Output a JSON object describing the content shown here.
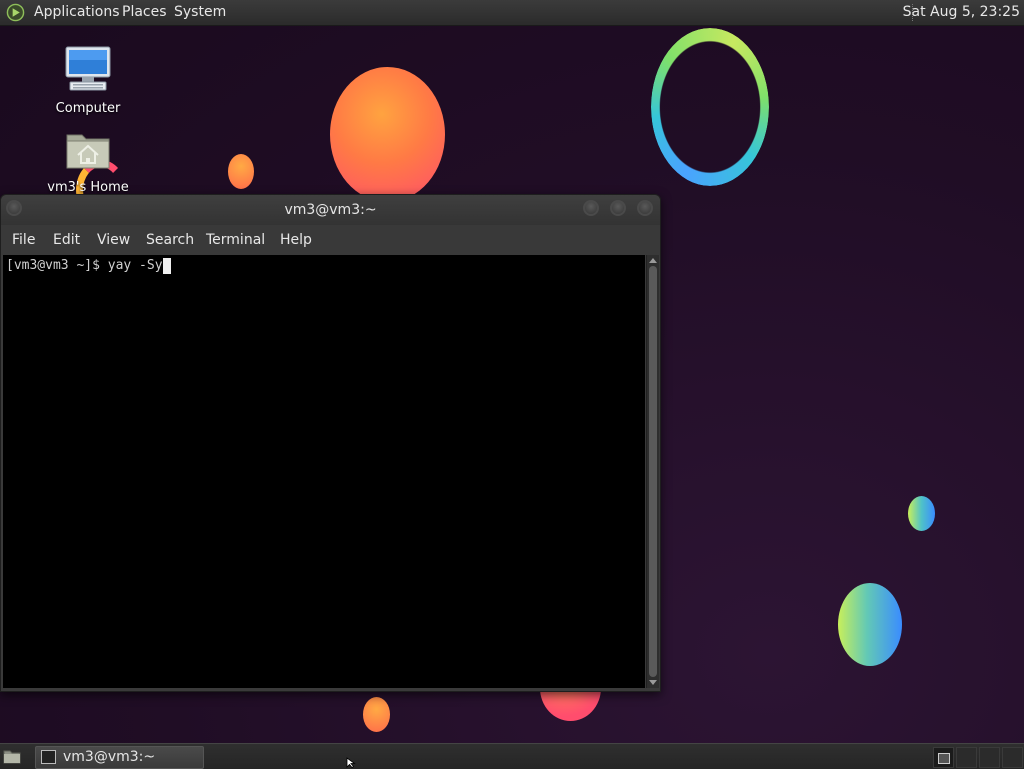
{
  "top_panel": {
    "menus": [
      "Applications",
      "Places",
      "System"
    ],
    "clock": "Sat Aug  5, 23:25"
  },
  "desktop": {
    "icons": [
      {
        "label": "Computer",
        "icon": "computer-icon"
      },
      {
        "label": "vm3's Home",
        "icon": "home-folder-icon"
      }
    ]
  },
  "terminal": {
    "title": "vm3@vm3:~",
    "menu": [
      "File",
      "Edit",
      "View",
      "Search",
      "Terminal",
      "Help"
    ],
    "prompt": "[vm3@vm3 ~]$ ",
    "command": "yay -Sy"
  },
  "bottom_panel": {
    "tasks": [
      {
        "label": "vm3@vm3:~",
        "icon": "terminal-icon"
      }
    ]
  },
  "colors": {
    "panel": "#2f2f2f",
    "wallpaper": "#200d25",
    "terminal_bg": "#000000",
    "terminal_fg": "#d0d0d0"
  }
}
